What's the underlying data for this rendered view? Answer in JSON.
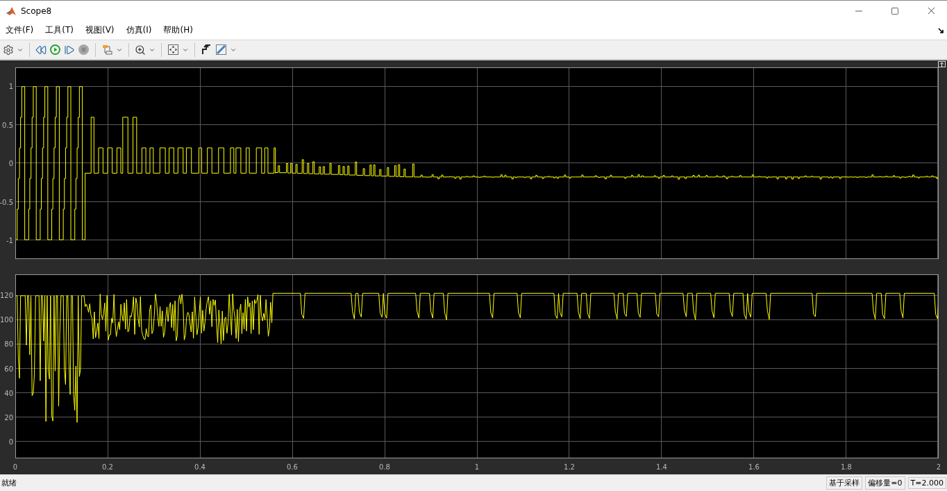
{
  "window": {
    "title": "Scope8"
  },
  "menu": [
    {
      "label": "文件(F)"
    },
    {
      "label": "工具(T)"
    },
    {
      "label": "视图(V)"
    },
    {
      "label": "仿真(I)"
    },
    {
      "label": "帮助(H)"
    }
  ],
  "plots": [
    {
      "y_ticks": [
        "1",
        "0.5",
        "0",
        "-0.5",
        "-1"
      ]
    },
    {
      "y_ticks": [
        "120",
        "100",
        "80",
        "60",
        "40",
        "20",
        "0"
      ]
    }
  ],
  "x_ticks": [
    "0",
    "0.2",
    "0.4",
    "0.6",
    "0.8",
    "1",
    "1.2",
    "1.4",
    "1.6",
    "1.8",
    "2"
  ],
  "status_bar": {
    "message": "就绪",
    "fields": [
      "基于采样",
      "偏移量=0",
      "T=2.000"
    ]
  }
}
